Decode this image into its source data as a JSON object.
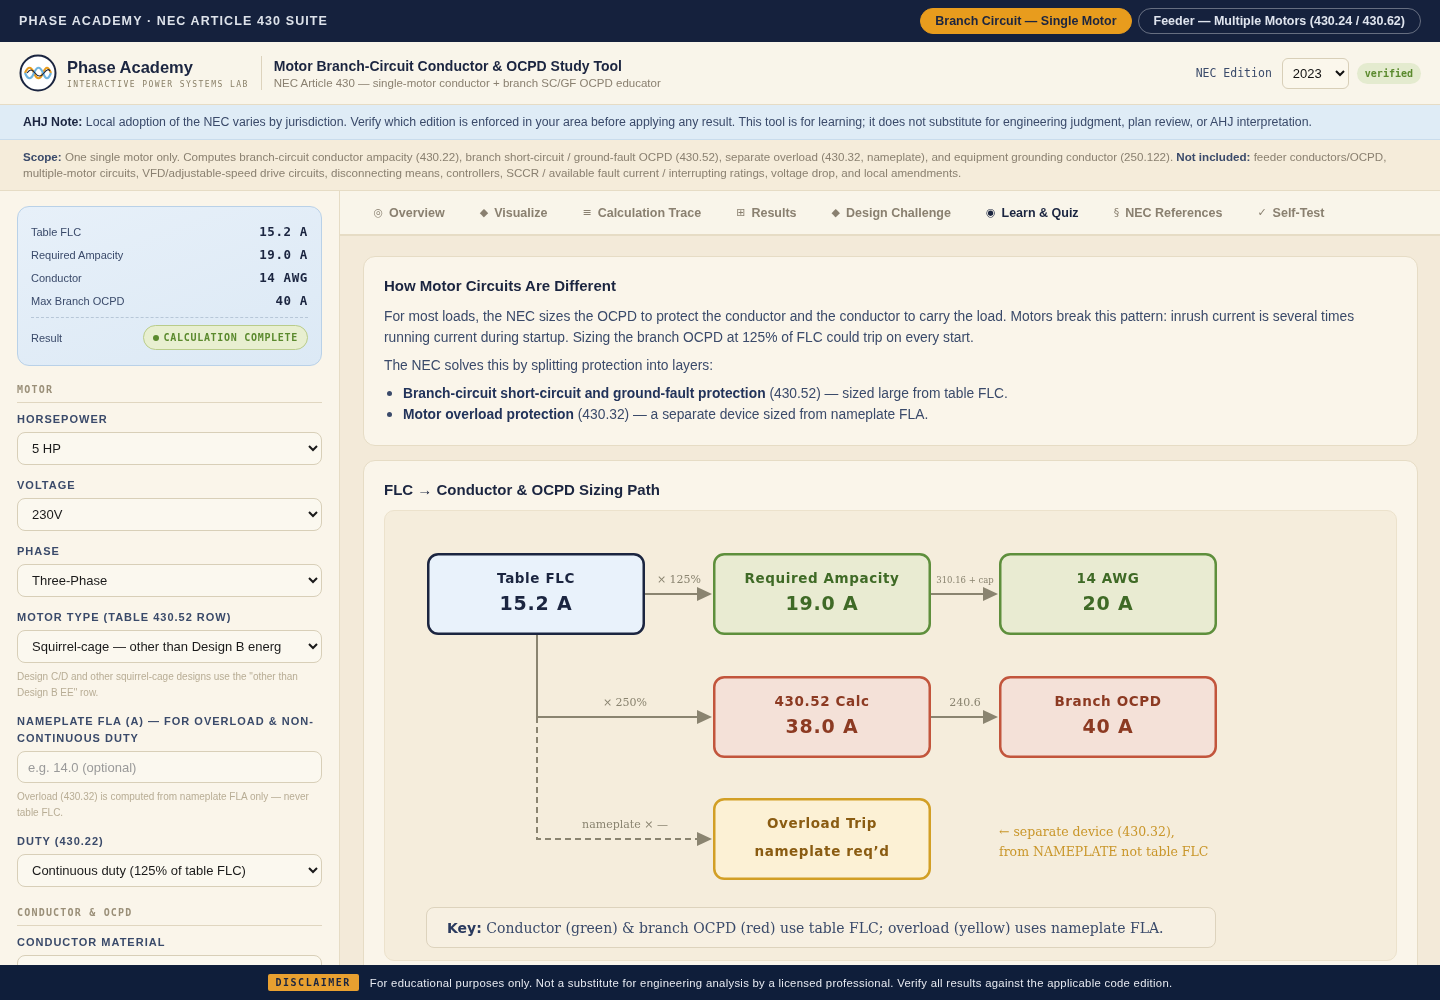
{
  "topbar": {
    "title": "PHASE ACADEMY · NEC ARTICLE 430 SUITE",
    "modes": [
      {
        "label": "Branch Circuit — Single Motor",
        "selected": true
      },
      {
        "label": "Feeder — Multiple Motors (430.24 / 430.62)",
        "selected": false
      }
    ]
  },
  "header": {
    "brand": "Phase Academy",
    "tagline": "INTERACTIVE POWER SYSTEMS LAB",
    "title": "Motor Branch-Circuit Conductor & OCPD Study Tool",
    "subtitle": "NEC Article 430 — single-motor conductor + branch SC/GF OCPD educator",
    "edition_label": "NEC Edition",
    "edition": "2023",
    "edition_badge": "verified"
  },
  "ahj_note": "**AHJ Note:** Local adoption of the NEC varies by jurisdiction. Verify which edition is enforced in your area before applying any result. This tool is for learning; it does not substitute for engineering judgment, plan review, or AHJ interpretation.",
  "scope": "**Scope:** One single motor only. Computes branch-circuit conductor ampacity (430.22), branch short-circuit / ground-fault OCPD (430.52), separate overload (430.32, nameplate), and equipment grounding conductor (250.122). **Not included:** feeder conductors/OCPD, multiple-motor circuits, VFD/adjustable-speed drive circuits, disconnecting means, controllers, SCCR / available fault current / interrupting ratings, voltage drop, and local amendments.",
  "summary": {
    "rows": [
      {
        "label": "Table FLC",
        "value": "15.2 A"
      },
      {
        "label": "Required Ampacity",
        "value": "19.0 A"
      },
      {
        "label": "Conductor",
        "value": "14 AWG"
      },
      {
        "label": "Max Branch OCPD",
        "value": "40 A"
      }
    ],
    "result_label": "Result",
    "result": "CALCULATION COMPLETE"
  },
  "sidebar": [
    {
      "heading": "MOTOR",
      "fields": [
        {
          "kind": "select",
          "label": "HORSEPOWER",
          "value": "5 HP"
        },
        {
          "kind": "select",
          "label": "VOLTAGE",
          "value": "230V"
        },
        {
          "kind": "select",
          "label": "PHASE",
          "value": "Three-Phase"
        },
        {
          "kind": "select",
          "label": "MOTOR TYPE (TABLE 430.52 ROW)",
          "value": "Squirrel-cage — other than Design B energ",
          "help": "Design C/D and other squirrel-cage designs use the \"other than Design B EE\" row."
        },
        {
          "kind": "input",
          "label": "NAMEPLATE FLA (A) — FOR OVERLOAD & NON-CONTINUOUS DUTY",
          "placeholder": "e.g. 14.0 (optional)",
          "help": "Overload (430.32) is computed from nameplate FLA only — never table FLC."
        },
        {
          "kind": "select",
          "label": "DUTY (430.22)",
          "value": "Continuous duty (125% of table FLC)"
        }
      ]
    },
    {
      "heading": "CONDUCTOR & OCPD",
      "fields": [
        {
          "kind": "select",
          "label": "CONDUCTOR MATERIAL"
        }
      ]
    }
  ],
  "tabs": [
    {
      "icon": "◎",
      "label": "Overview",
      "selected": false
    },
    {
      "icon": "◆",
      "label": "Visualize",
      "selected": false
    },
    {
      "icon": "≡",
      "label": "Calculation Trace",
      "selected": false
    },
    {
      "icon": "⊞",
      "label": "Results",
      "selected": false
    },
    {
      "icon": "◆",
      "label": "Design Challenge",
      "selected": false
    },
    {
      "icon": "◉",
      "label": "Learn & Quiz",
      "selected": true
    },
    {
      "icon": "§",
      "label": "NEC References",
      "selected": false
    },
    {
      "icon": "✓",
      "label": "Self-Test",
      "selected": false
    }
  ],
  "learn": {
    "title": "How Motor Circuits Are Different",
    "paragraphs": [
      "For most loads, the NEC sizes the OCPD to protect the conductor and the conductor to carry the load. Motors break this pattern: inrush current is several times running current during startup. Sizing the branch OCPD at 125% of FLC could trip on every start.",
      "The NEC solves this by splitting protection into layers:"
    ],
    "bullets": [
      "**Branch-circuit short-circuit and ground-fault protection** (430.52) — sized large from table FLC.",
      "**Motor overload protection** (430.32) — a separate device sized from nameplate FLA."
    ]
  },
  "diagram": {
    "title": "FLC → Conductor & OCPD Sizing Path",
    "nodes": [
      {
        "kind": "input",
        "title": "Table FLC",
        "value": "15.2 A"
      },
      {
        "kind": "conductor",
        "title": "Required Ampacity",
        "value": "19.0 A"
      },
      {
        "kind": "conductor",
        "title": "14 AWG",
        "value": "20 A"
      },
      {
        "kind": "ocpd",
        "title": "430.52 Calc",
        "value": "38.0 A"
      },
      {
        "kind": "ocpd",
        "title": "Branch OCPD",
        "value": "40 A"
      },
      {
        "kind": "overload",
        "title": "Overload Trip",
        "value": "nameplate req’d"
      }
    ],
    "edges": [
      {
        "kind": "solid",
        "label": "× 125%"
      },
      {
        "kind": "solid",
        "label": "310.16 + cap"
      },
      {
        "kind": "solid",
        "label": "× 250%"
      },
      {
        "kind": "solid",
        "label": "240.6"
      },
      {
        "kind": "dashed",
        "label": "nameplate × —"
      }
    ],
    "note": [
      "← separate device (430.32),",
      "from NAMEPLATE not table FLC"
    ],
    "key": "**Key:** Conductor (green) & branch OCPD (red) use table FLC; overload (yellow) uses nameplate FLA."
  },
  "footer": {
    "badge": "DISCLAIMER",
    "text": "For educational purposes only. Not a substitute for engineering analysis by a licensed professional. Verify all results against the applicable code edition."
  }
}
